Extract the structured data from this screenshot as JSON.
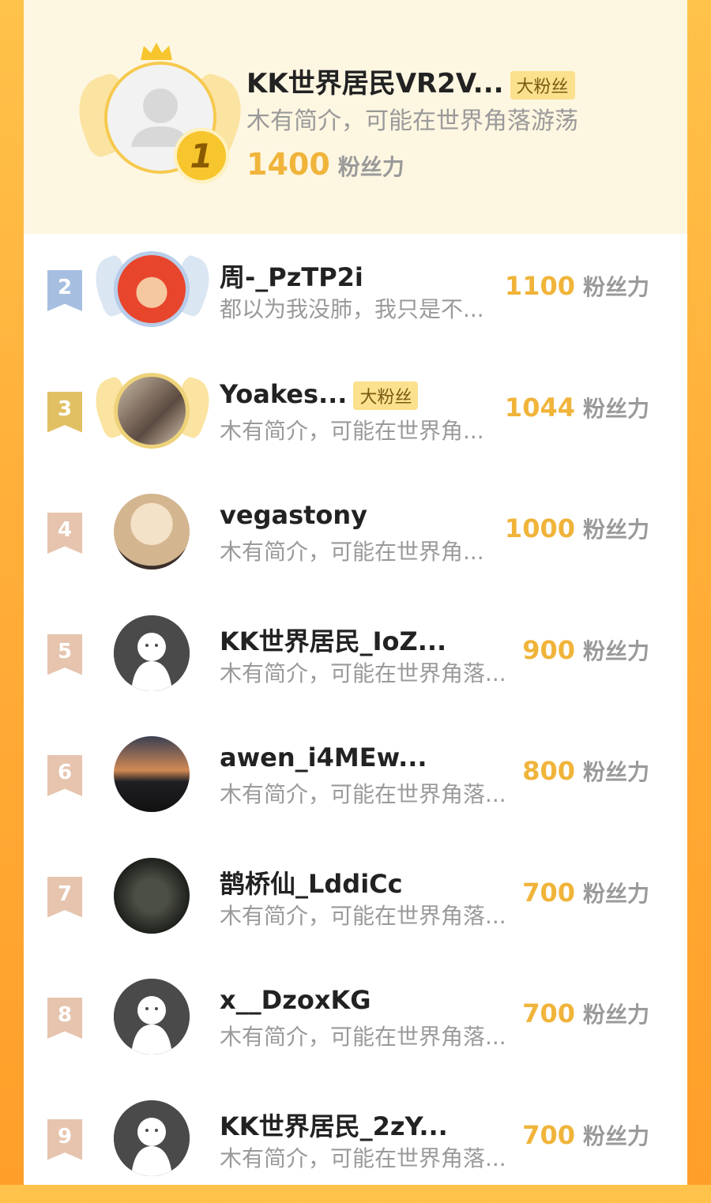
{
  "colors": {
    "accent": "#f0b43a",
    "background": "#ffb03a",
    "badge": "#fbe08d"
  },
  "top": {
    "rank": "1",
    "name": "KK世界居民VR2V...",
    "badge": "大粉丝",
    "bio": "木有简介，可能在世界角落游荡",
    "score": "1400",
    "unit": "粉丝力",
    "avatar_icon": "default-avatar-icon"
  },
  "rows": [
    {
      "rank": "2",
      "name": "周-_PzTP2i",
      "bio": "都以为我没肺，我只是不...",
      "score": "1100",
      "unit": "粉丝力",
      "badge": ""
    },
    {
      "rank": "3",
      "name": "Yoakes...",
      "bio": "木有简介，可能在世界角...",
      "score": "1044",
      "unit": "粉丝力",
      "badge": "大粉丝"
    },
    {
      "rank": "4",
      "name": "vegastony",
      "bio": "木有简介，可能在世界角...",
      "score": "1000",
      "unit": "粉丝力",
      "badge": ""
    },
    {
      "rank": "5",
      "name": "KK世界居民_IoZ...",
      "bio": "木有简介，可能在世界角落...",
      "score": "900",
      "unit": "粉丝力",
      "badge": ""
    },
    {
      "rank": "6",
      "name": "awen_i4MEw...",
      "bio": "木有简介，可能在世界角落...",
      "score": "800",
      "unit": "粉丝力",
      "badge": ""
    },
    {
      "rank": "7",
      "name": "鹊桥仙_LddiCc",
      "bio": "木有简介，可能在世界角落...",
      "score": "700",
      "unit": "粉丝力",
      "badge": ""
    },
    {
      "rank": "8",
      "name": "x__DzoxKG",
      "bio": "木有简介，可能在世界角落...",
      "score": "700",
      "unit": "粉丝力",
      "badge": ""
    },
    {
      "rank": "9",
      "name": "KK世界居民_2zY...",
      "bio": "木有简介，可能在世界角落...",
      "score": "700",
      "unit": "粉丝力",
      "badge": ""
    }
  ]
}
